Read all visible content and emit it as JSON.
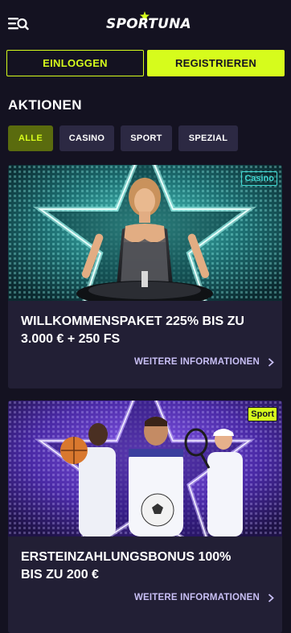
{
  "header": {
    "logo_text": "SPORTUNA",
    "colors": {
      "accent": "#d6fc1c",
      "background": "#141221"
    }
  },
  "auth": {
    "login_label": "EINLOGGEN",
    "register_label": "REGISTRIEREN"
  },
  "promotions": {
    "title": "AKTIONEN",
    "filters": [
      {
        "label": "ALLE",
        "active": true
      },
      {
        "label": "CASINO",
        "active": false
      },
      {
        "label": "SPORT",
        "active": false
      },
      {
        "label": "SPEZIAL",
        "active": false
      }
    ],
    "cards": [
      {
        "badge": "Casino",
        "title_line1": "WILLKOMMENSPAKET 225% BIS ZU",
        "title_line2": "3.000 € + 250 FS",
        "link_label": "WEITERE INFORMATIONEN"
      },
      {
        "badge": "Sport",
        "title_line1": "ERSTEINZAHLUNGSBONUS 100%",
        "title_line2": "BIS ZU 200 €",
        "link_label": "WEITERE INFORMATIONEN"
      }
    ]
  }
}
